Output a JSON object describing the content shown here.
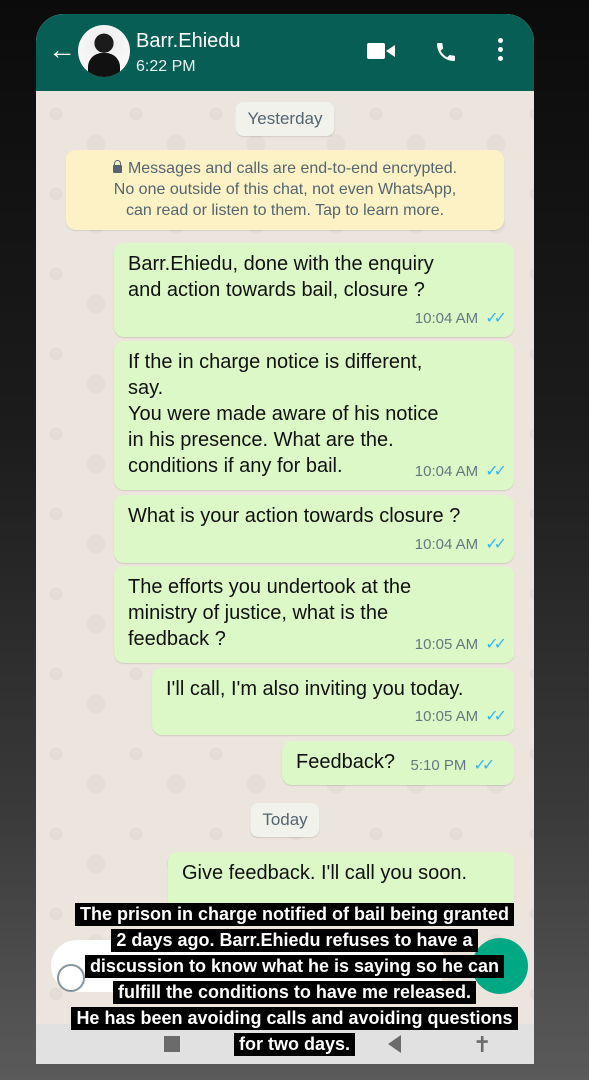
{
  "header": {
    "contact_name": "Barr.Ehiedu",
    "status": "6:22 PM",
    "back_icon": "arrow-left-icon",
    "video_icon": "video-camera-icon",
    "call_icon": "phone-icon",
    "menu_icon": "more-vertical-icon"
  },
  "chips": {
    "yesterday": "Yesterday",
    "today": "Today"
  },
  "encryption_notice": {
    "line1": "Messages and calls are end-to-end encrypted.",
    "line2": "No one outside of this chat, not even WhatsApp,",
    "line3": "can read or listen to them. Tap to learn more."
  },
  "messages": [
    {
      "text": "Barr.Ehiedu, done with the enquiry\nand action towards bail, closure ?",
      "time": "10:04 AM"
    },
    {
      "text": "If the in charge notice is different,\nsay.\nYou were made aware of his notice\nin his presence. What are the.\nconditions if any for bail.",
      "time": "10:04 AM"
    },
    {
      "text": "What is your action towards closure ?",
      "time": "10:04 AM"
    },
    {
      "text": "The efforts you undertook at the\nministry of justice, what is the\nfeedback ?",
      "time": "10:05 AM"
    },
    {
      "text": "I'll call, I'm also inviting you today.",
      "time": "10:05 AM"
    },
    {
      "text": "Feedback?",
      "time": "5:10 PM"
    },
    {
      "text": "Give feedback. I'll call you soon.",
      "time": ""
    }
  ],
  "caption": {
    "line1": "The prison in charge notified of bail being granted",
    "line2": "2 days ago. Barr.Ehiedu refuses to have a",
    "line3": "discussion to know what he is saying so he can",
    "line4": "fulfill the conditions to have me released.",
    "line5": "He has been avoiding calls and avoiding questions",
    "line6": "for two days."
  },
  "colors": {
    "header": "#075e54",
    "outgoing_bubble": "#dcf8c6",
    "read_ticks": "#34b7f1",
    "accent": "#00a884"
  }
}
